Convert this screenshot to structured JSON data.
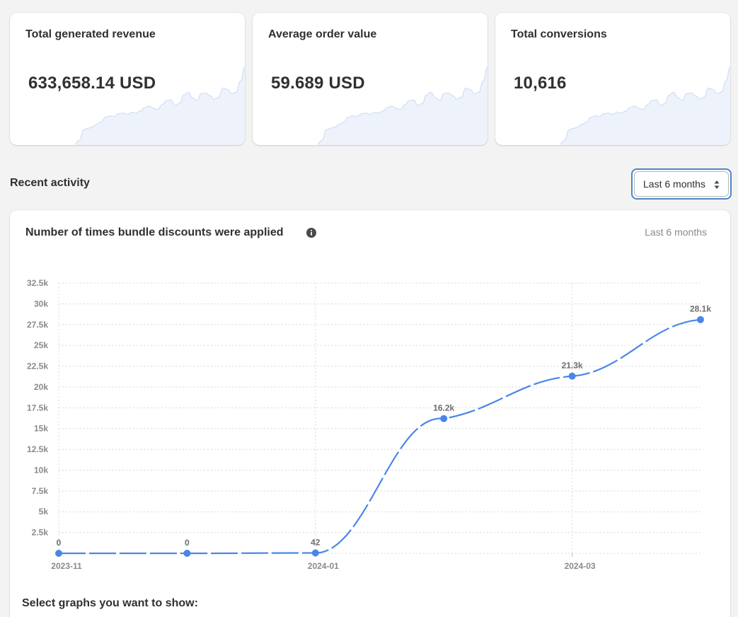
{
  "stats": [
    {
      "title": "Total generated revenue",
      "value": "633,658.14 USD"
    },
    {
      "title": "Average order value",
      "value": "59.689 USD"
    },
    {
      "title": "Total conversions",
      "value": "10,616"
    }
  ],
  "sparkline": [
    0,
    5,
    20,
    22,
    24,
    28,
    31,
    38,
    40,
    39,
    43,
    44,
    42,
    45,
    44,
    47,
    52,
    54,
    51,
    49,
    56,
    62,
    63,
    55,
    58,
    70,
    74,
    66,
    62,
    72,
    73,
    69,
    64,
    67,
    80,
    78,
    72,
    74,
    90,
    110
  ],
  "recent_activity": {
    "title": "Recent activity",
    "range_select": "Last 6 months"
  },
  "chart_card": {
    "title": "Number of times bundle discounts were applied",
    "range_label": "Last 6 months",
    "footer": "Select graphs you want to show:"
  },
  "colors": {
    "accent": "#4a86e8",
    "sparkline_fill": "#eef3fb",
    "sparkline_stroke": "#cfdff4"
  },
  "chart_data": {
    "type": "line",
    "title": "Number of times bundle discounts were applied",
    "x": [
      "2023-11",
      "2023-12",
      "2024-01",
      "2024-02",
      "2024-03",
      "2024-04"
    ],
    "x_tick_labels": [
      "2023-11",
      "",
      "2024-01",
      "",
      "2024-03",
      ""
    ],
    "series": [
      {
        "values": [
          0,
          0,
          42,
          16200,
          21300,
          28100
        ],
        "labels": [
          "0",
          "0",
          "42",
          "16.2k",
          "21.3k",
          "28.1k"
        ]
      }
    ],
    "y_ticks": [
      "2.5k",
      "5k",
      "7.5k",
      "10k",
      "12.5k",
      "15k",
      "17.5k",
      "20k",
      "22.5k",
      "25k",
      "27.5k",
      "30k",
      "32.5k"
    ],
    "ylim": [
      0,
      32500
    ],
    "grid": true,
    "line_style": "dashed"
  }
}
